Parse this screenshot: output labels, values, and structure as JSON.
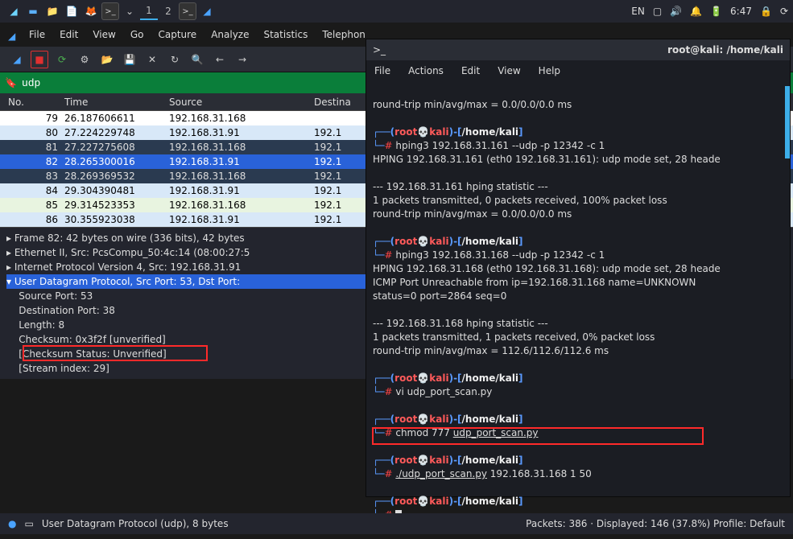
{
  "taskbar": {
    "workspaces": [
      "1",
      "2"
    ],
    "lang": "EN",
    "time": "6:47"
  },
  "wireshark": {
    "menu": [
      "File",
      "Edit",
      "View",
      "Go",
      "Capture",
      "Analyze",
      "Statistics",
      "Telephon"
    ],
    "filter": "udp",
    "cols": {
      "no": "No.",
      "time": "Time",
      "source": "Source",
      "dest": "Destina"
    },
    "packets": [
      {
        "no": "79",
        "time": "26.187606611",
        "src": "192.168.31.168",
        "dst": "",
        "cls": "r-w"
      },
      {
        "no": "80",
        "time": "27.224229748",
        "src": "192.168.31.91",
        "dst": "192.1",
        "cls": "r-l1"
      },
      {
        "no": "81",
        "time": "27.227275608",
        "src": "192.168.31.168",
        "dst": "192.1",
        "cls": "r-d1"
      },
      {
        "no": "82",
        "time": "28.265300016",
        "src": "192.168.31.91",
        "dst": "192.1",
        "cls": "r-sel"
      },
      {
        "no": "83",
        "time": "28.269369532",
        "src": "192.168.31.168",
        "dst": "192.1",
        "cls": "r-d1"
      },
      {
        "no": "84",
        "time": "29.304390481",
        "src": "192.168.31.91",
        "dst": "192.1",
        "cls": "r-l2"
      },
      {
        "no": "85",
        "time": "29.314523353",
        "src": "192.168.31.168",
        "dst": "192.1",
        "cls": "r-g1"
      },
      {
        "no": "86",
        "time": "30.355923038",
        "src": "192.168.31.91",
        "dst": "192.1",
        "cls": "r-l2"
      }
    ],
    "details": {
      "l1": "Frame 82: 42 bytes on wire (336 bits), 42 bytes",
      "l2": "Ethernet II, Src: PcsCompu_50:4c:14 (08:00:27:5",
      "l3": "Internet Protocol Version 4, Src: 192.168.31.91",
      "l4": "User Datagram Protocol, Src Port: 53, Dst Port:",
      "l5": "Source Port: 53",
      "l6": "Destination Port: 38",
      "l7": "Length: 8",
      "l8": "Checksum: 0x3f2f [unverified]",
      "l9": "[Checksum Status: Unverified]",
      "l10": "[Stream index: 29]"
    },
    "status": {
      "left": "User Datagram Protocol (udp), 8 bytes",
      "right": "Packets: 386 · Displayed: 146 (37.8%)     Profile: Default"
    }
  },
  "terminal": {
    "title": "root@kali: /home/kali",
    "menu": [
      "File",
      "Actions",
      "Edit",
      "View",
      "Help"
    ],
    "body": {
      "rt": "round-trip min/avg/max = 0.0/0.0/0.0 ms",
      "prompt_user": "root",
      "prompt_skull": "💀",
      "prompt_host": "kali",
      "prompt_path": "/home/kali",
      "cmd1": "hping3 192.168.31.161 --udp -p 12342 -c 1",
      "hp1a": "HPING 192.168.31.161 (eth0 192.168.31.161): udp mode set, 28 heade",
      "stat161": "--- 192.168.31.161 hping statistic ---",
      "st1a": "1 packets transmitted, 0 packets received, 100% packet loss",
      "st1b": "round-trip min/avg/max = 0.0/0.0/0.0 ms",
      "cmd2": "hping3 192.168.31.168 --udp -p 12342 -c 1",
      "hp2a": "HPING 192.168.31.168 (eth0 192.168.31.168): udp mode set, 28 heade",
      "hp2b": "ICMP Port Unreachable from ip=192.168.31.168 name=UNKNOWN",
      "hp2c": "status=0 port=2864 seq=0",
      "stat168": "--- 192.168.31.168 hping statistic ---",
      "st2a": "1 packets transmitted, 1 packets received, 0% packet loss",
      "st2b": "round-trip min/avg/max = 112.6/112.6/112.6 ms",
      "cmd3": "vi udp_port_scan.py",
      "cmd4": "chmod 777 ",
      "cmd4a": "udp_port_scan.py",
      "cmd5": "./udp_port_scan.py",
      "cmd5a": " 192.168.31.168 1 50"
    }
  }
}
